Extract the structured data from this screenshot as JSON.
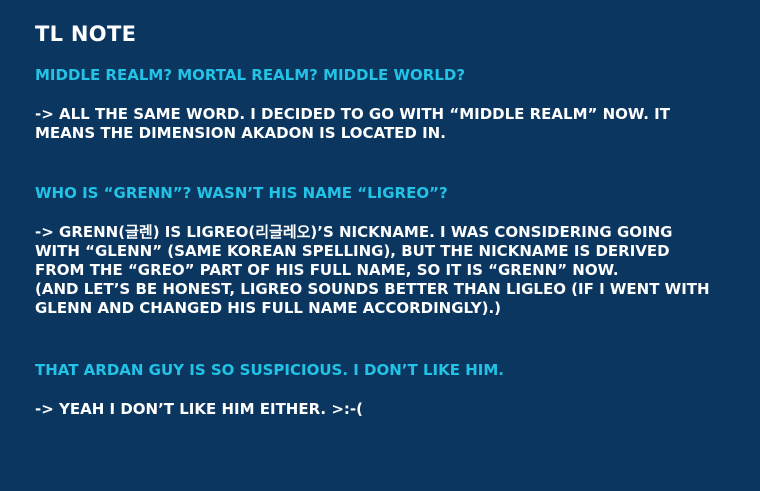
{
  "title": "TL NOTE",
  "notes": [
    {
      "question": "MIDDLE REALM? MORTAL REALM? MIDDLE WORLD?",
      "answer_lines": [
        "-> ALL THE SAME WORD. I DECIDED TO GO WITH “MIDDLE REALM” NOW. IT",
        "MEANS THE DIMENSION AKADON IS LOCATED IN."
      ]
    },
    {
      "question": "WHO IS “GRENN”? WASN’T HIS NAME “LIGREO”?",
      "answer_lines": [
        "-> GRENN(글렌) IS LIGREO(리글레오)’S NICKNAME. I WAS CONSIDERING GOING",
        "WITH “GLENN” (SAME KOREAN SPELLING), BUT THE NICKNAME IS DERIVED",
        "FROM THE “GREO” PART OF HIS FULL NAME, SO IT IS “GRENN” NOW.",
        "(AND LET’S BE HONEST, LIGREO SOUNDS BETTER THAN LIGLEO (IF I WENT WITH",
        "GLENN AND CHANGED HIS FULL NAME ACCORDINGLY).)"
      ]
    },
    {
      "question": "THAT ARDAN GUY IS SO SUSPICIOUS. I DON’T LIKE HIM.",
      "answer_lines": [
        "-> YEAH I DON’T LIKE HIM EITHER. >:-("
      ]
    }
  ]
}
